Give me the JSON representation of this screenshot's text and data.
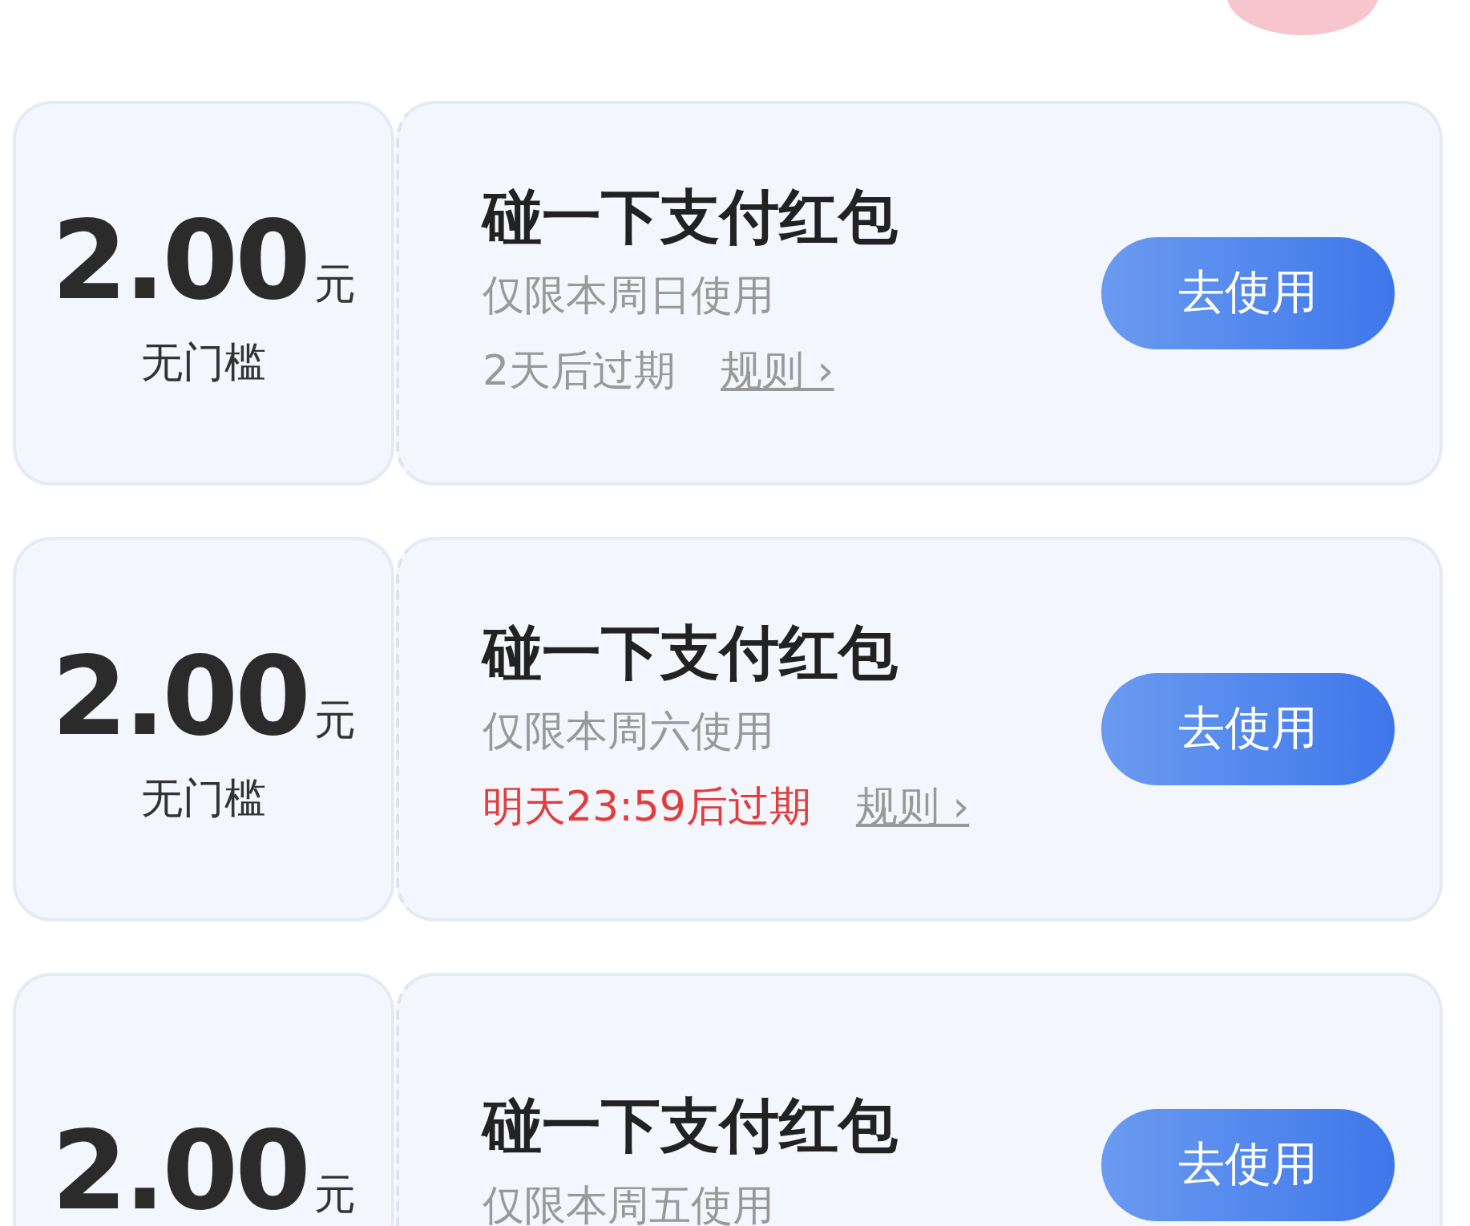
{
  "coupons": [
    {
      "amount": "2.00",
      "unit": "元",
      "threshold": "无门槛",
      "title": "碰一下支付红包",
      "validity": "仅限本周日使用",
      "expiry": "2天后过期",
      "urgent": false,
      "rules": "规则",
      "rules_arrow": "›",
      "button": "去使用"
    },
    {
      "amount": "2.00",
      "unit": "元",
      "threshold": "无门槛",
      "title": "碰一下支付红包",
      "validity": "仅限本周六使用",
      "expiry": "明天23:59后过期",
      "urgent": true,
      "rules": "规则",
      "rules_arrow": "›",
      "button": "去使用"
    },
    {
      "amount": "2.00",
      "unit": "元",
      "title": "碰一下支付红包",
      "validity": "仅限本周五使用",
      "button": "去使用"
    }
  ]
}
